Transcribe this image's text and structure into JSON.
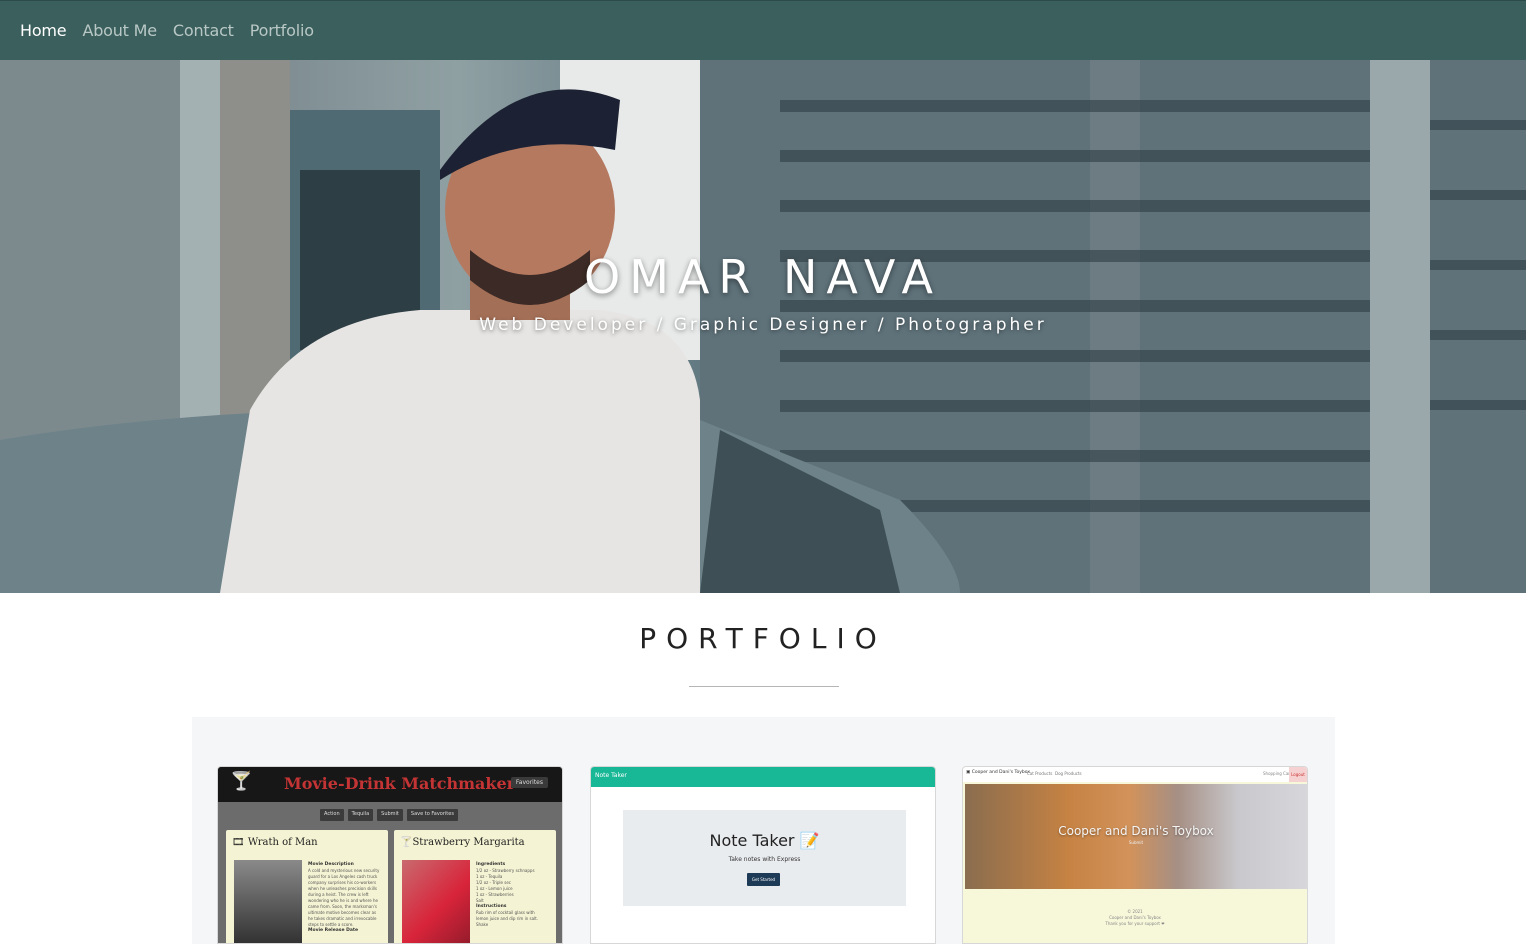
{
  "nav": {
    "items": [
      {
        "label": "Home",
        "active": true
      },
      {
        "label": "About Me",
        "active": false
      },
      {
        "label": "Contact",
        "active": false
      },
      {
        "label": "Portfolio",
        "active": false
      }
    ],
    "background": "#3a5f5c"
  },
  "hero": {
    "title": "OMAR NAVA",
    "subtitle": "Web Developer / Graphic Designer / Photographer"
  },
  "portfolio": {
    "heading": "PORTFOLIO",
    "cards": [
      {
        "title": "Movie-Drink Matchmaker",
        "favorites": "Favorites",
        "controls": [
          "Action",
          "Tequila",
          "Submit",
          "Save to Favorites"
        ],
        "panel1_title": "Wrath of Man",
        "panel1_label": "Movie Description",
        "panel1_text": "A cold and mysterious new security guard for a Los Angeles cash truck company surprises his co-workers when he unleashes precision skills during a heist. The crew is left wondering who he is and where he came from. Soon, the marksman's ultimate motive becomes clear as he takes dramatic and irrevocable steps to settle a score.",
        "panel1_footer": "Movie Release Date",
        "panel2_title": "Strawberry Margarita",
        "panel2_label": "Ingredients",
        "panel2_items": [
          "1/2 oz - Strawberry schnapps",
          "1 oz - Tequila",
          "1/2 oz - Triple sec",
          "1 oz - Lemon juice",
          "1 oz - Strawberries",
          "Salt"
        ],
        "panel2_label2": "Instructions",
        "panel2_text2": "Rub rim of cocktail glass with lemon juice and dip rim in salt. Shake"
      },
      {
        "header": "Note Taker",
        "title": "Note Taker 📝",
        "subtitle": "Take notes with Express",
        "button": "Get Started"
      },
      {
        "brand": "Cooper and Dani's Toybox",
        "links": [
          "Cat Products",
          "Dog Products"
        ],
        "right_link": "Shopping Cart",
        "logout": "Logout",
        "image_title": "Cooper and Dani's Toybox",
        "image_sub": "Submit",
        "footer": [
          "© 2021",
          "Cooper and Dani's Toybox",
          "Thank you for your support ❤"
        ]
      }
    ]
  }
}
